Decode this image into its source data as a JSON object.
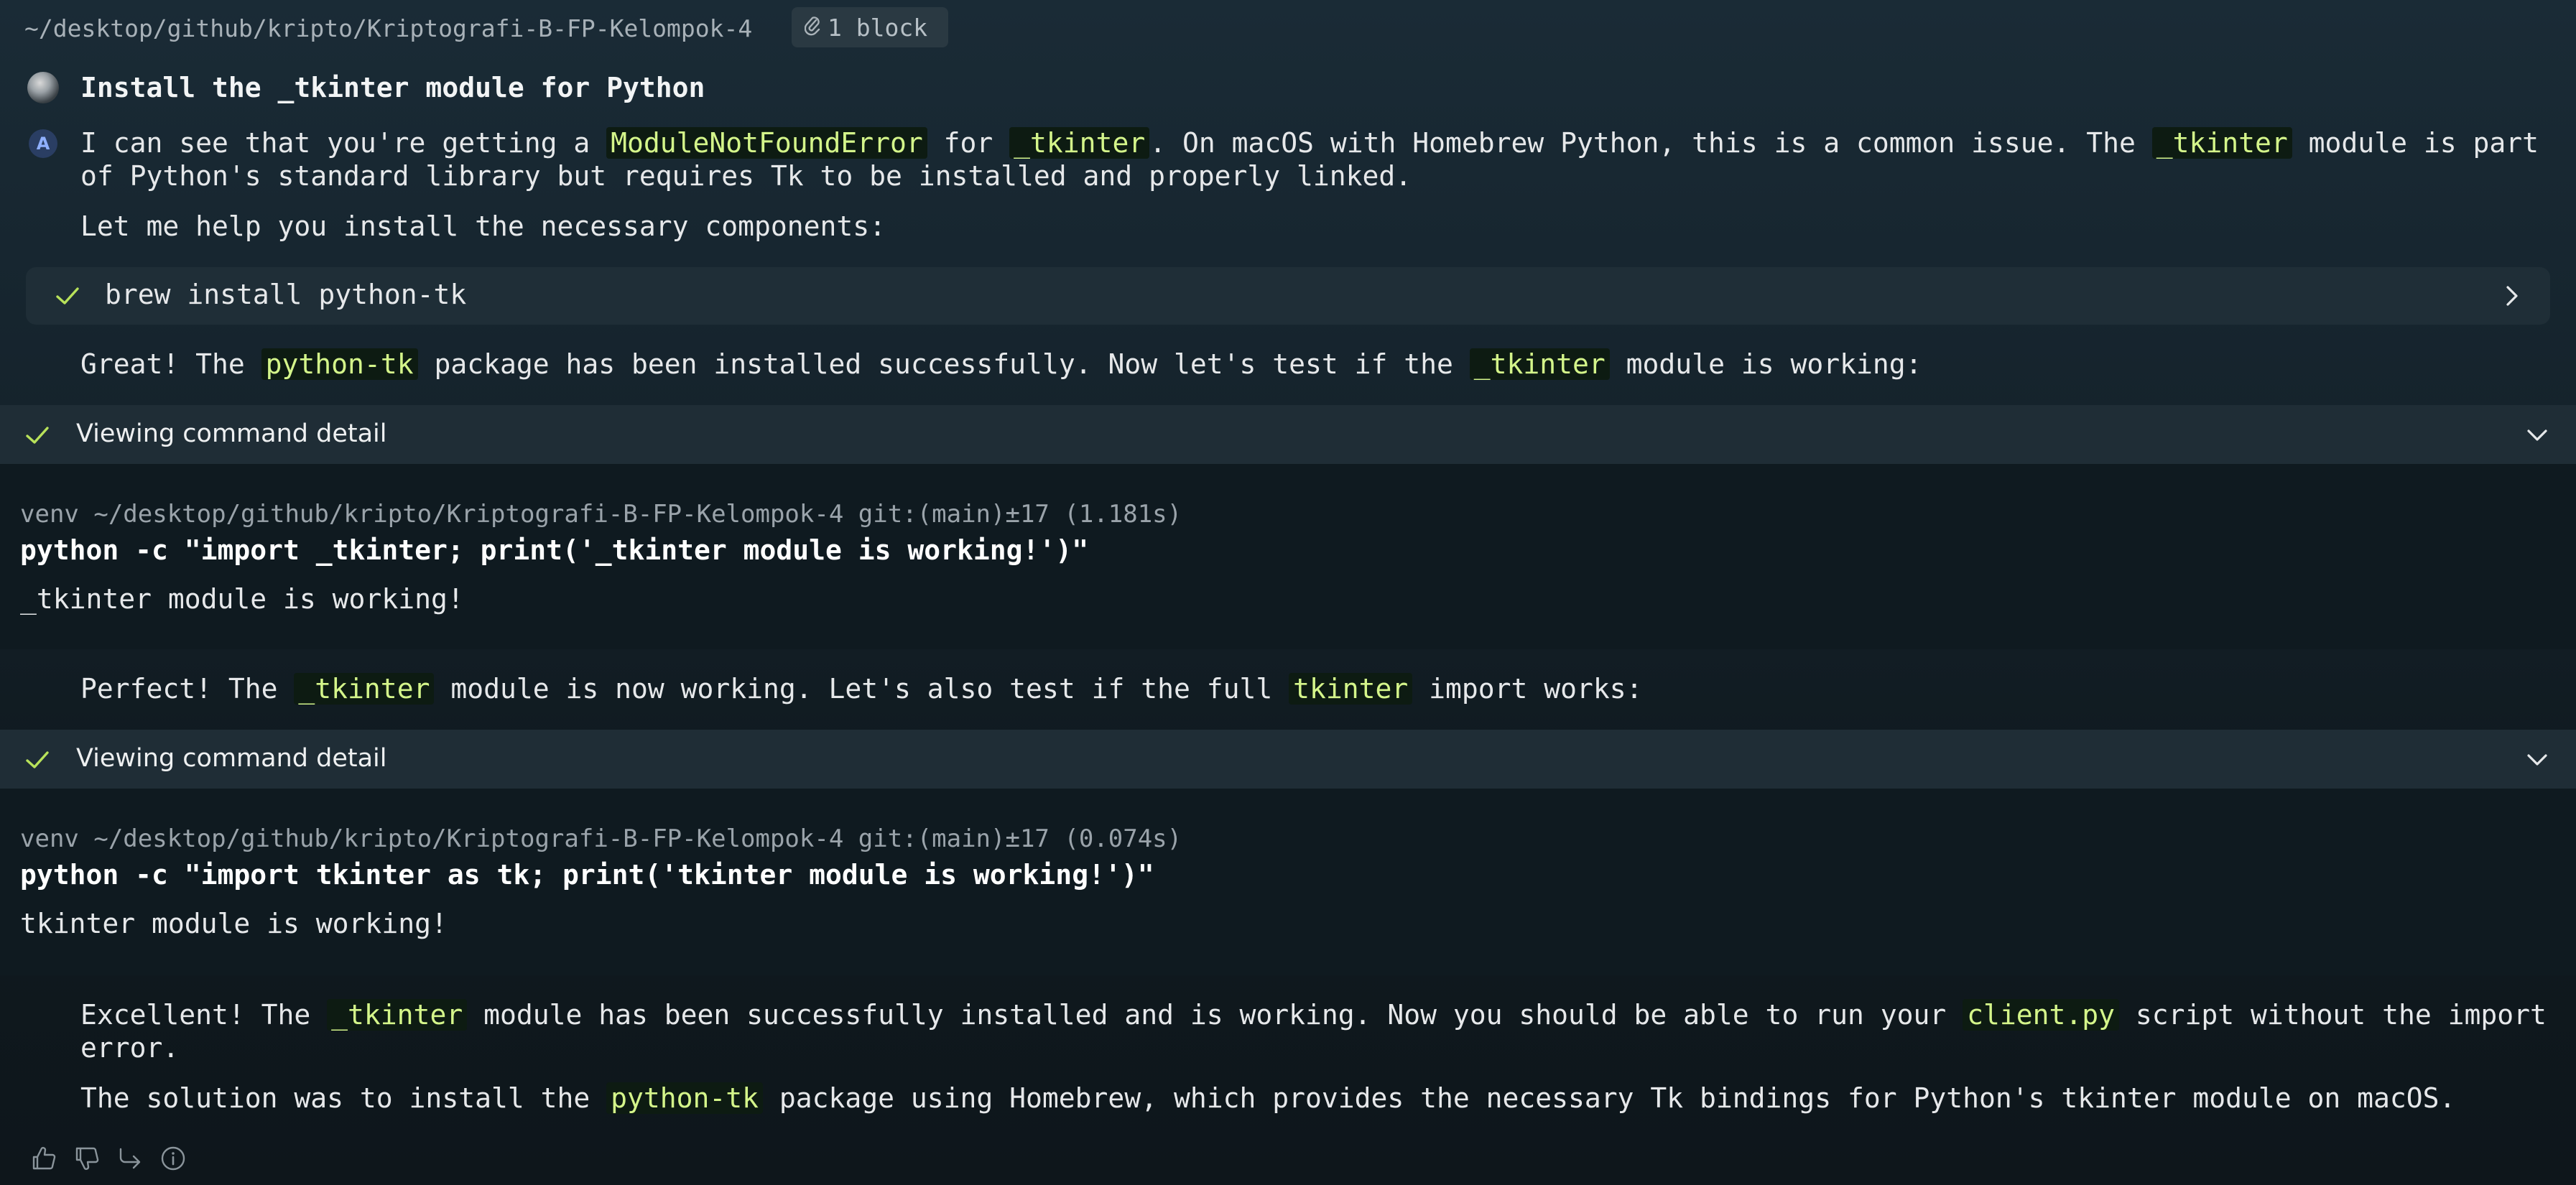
{
  "header": {
    "path": "~/desktop/github/kripto/Kriptografi-B-FP-Kelompok-4",
    "block_badge": "1 block"
  },
  "conversation": {
    "title": "Install the _tkinter module for Python",
    "p1": {
      "t1": "I can see that you're getting a ",
      "c1": "ModuleNotFoundError",
      "t2": " for ",
      "c2": "_tkinter",
      "t3": ". On macOS with Homebrew Python, this is a common issue. The ",
      "c3": "_tkinter",
      "t4": " module is part of Python's standard library but requires Tk to be installed and properly linked."
    },
    "p2": "Let me help you install the necessary components:",
    "command_pill": "brew install python-tk",
    "p3": {
      "t1": "Great! The ",
      "c1": "python-tk",
      "t2": " package has been installed successfully. Now let's test if the ",
      "c2": "_tkinter",
      "t3": " module is working:"
    },
    "detail1": {
      "label": "Viewing command detail",
      "prompt": "venv ~/desktop/github/kripto/Kriptografi-B-FP-Kelompok-4 git:(main)±17 (1.181s)",
      "command": "python -c \"import _tkinter; print('_tkinter module is working!')\"",
      "output": "_tkinter module is working!"
    },
    "p4": {
      "t1": "Perfect! The ",
      "c1": "_tkinter",
      "t2": " module is now working. Let's also test if the full ",
      "c2": "tkinter",
      "t3": " import works:"
    },
    "detail2": {
      "label": "Viewing command detail",
      "prompt": "venv ~/desktop/github/kripto/Kriptografi-B-FP-Kelompok-4 git:(main)±17 (0.074s)",
      "command": "python -c \"import tkinter as tk; print('tkinter module is working!')\"",
      "output": "tkinter module is working!"
    },
    "p5": {
      "t1": "Excellent! The ",
      "c1": "_tkinter",
      "t2": " module has been successfully installed and is working. Now you should be able to run your ",
      "c2": "client.py",
      "t3": " script without the import error."
    },
    "p6": {
      "t1": "The solution was to install the ",
      "c1": "python-tk",
      "t2": " package using Homebrew, which provides the necessary Tk bindings for Python's tkinter module on macOS."
    }
  },
  "agent_icon_letter": "A",
  "footer_icons": [
    "thumbs-up-icon",
    "thumbs-down-icon",
    "share-arrow-icon",
    "info-icon"
  ],
  "colors": {
    "highlight_text": "#d4f58a",
    "check_green": "#b8e25a",
    "background": "#15232c"
  }
}
